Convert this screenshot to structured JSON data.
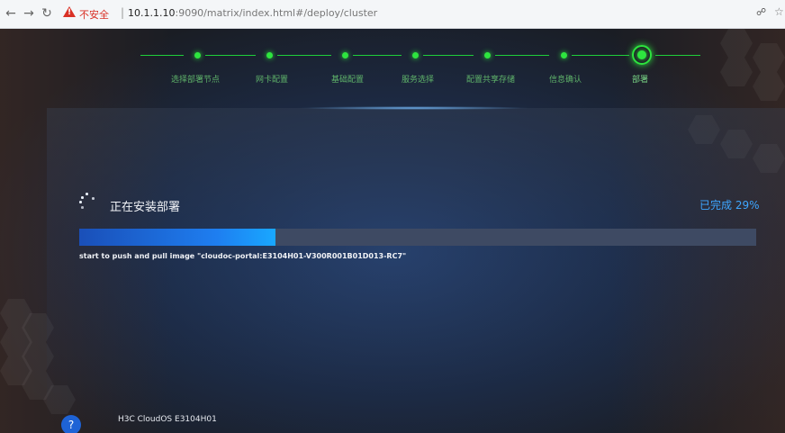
{
  "browser": {
    "insecure_label": "不安全",
    "separator": "|",
    "url_host": "10.1.1.10",
    "url_rest": ":9090/matrix/index.html#/deploy/cluster"
  },
  "steps": [
    {
      "label": "选择部署节点",
      "status": "done"
    },
    {
      "label": "网卡配置",
      "status": "done"
    },
    {
      "label": "基础配置",
      "status": "done"
    },
    {
      "label": "服务选择",
      "status": "done"
    },
    {
      "label": "配置共享存储",
      "status": "done"
    },
    {
      "label": "信息确认",
      "status": "done"
    },
    {
      "label": "部署",
      "status": "current"
    }
  ],
  "progress": {
    "title": "正在安装部署",
    "percent_text": "已完成 29%",
    "percent_value": 29,
    "log_line": "start to push and pull image \"cloudoc-portal:E3104H01-V300R001B01D013-RC7\""
  },
  "footer": {
    "help_label": "?",
    "product": "H3C CloudOS E3104H01"
  },
  "colors": {
    "accent_green": "#2ee53f",
    "progress_blue": "#1e7ef0",
    "percent_text": "#3ea6ff"
  },
  "icons": {
    "back": "arrow-left",
    "forward": "arrow-right",
    "reload": "reload",
    "warning": "warning-triangle",
    "password": "key",
    "bookmark": "star"
  }
}
